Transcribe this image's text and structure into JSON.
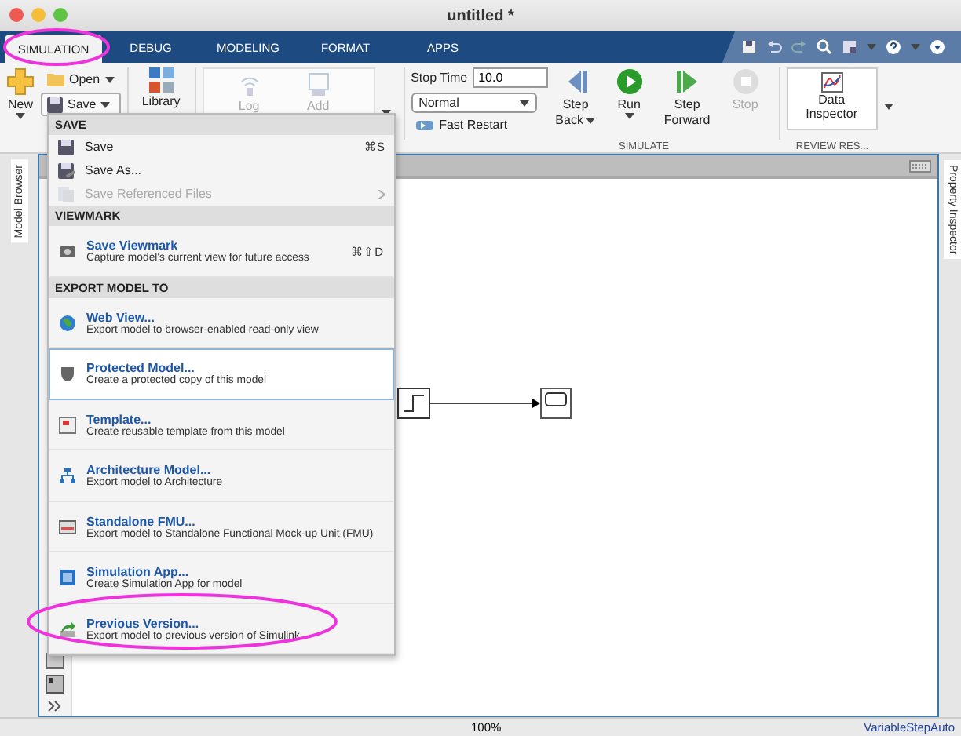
{
  "window": {
    "title": "untitled *"
  },
  "tabs": [
    {
      "label": "SIMULATION",
      "selected": true
    },
    {
      "label": "DEBUG",
      "selected": false
    },
    {
      "label": "MODELING",
      "selected": false
    },
    {
      "label": "FORMAT",
      "selected": false
    },
    {
      "label": "APPS",
      "selected": false
    }
  ],
  "toolstrip": {
    "new": "New",
    "open": "Open",
    "save": "Save",
    "library": "Library",
    "prepare": [
      {
        "label": "Log",
        "disabled": true
      },
      {
        "label": "Add",
        "disabled": true
      }
    ],
    "stop_time": {
      "label": "Stop Time",
      "value": "10.0"
    },
    "mode": {
      "value": "Normal"
    },
    "fast_restart": "Fast Restart",
    "sim_buttons": [
      {
        "kind": "step-back",
        "lines": [
          "Step",
          "Back"
        ],
        "disabled": false,
        "dropdown": true
      },
      {
        "kind": "run",
        "lines": [
          "Run"
        ],
        "disabled": false,
        "dropdown": true
      },
      {
        "kind": "step-forward",
        "lines": [
          "Step",
          "Forward"
        ],
        "disabled": false,
        "dropdown": false
      },
      {
        "kind": "stop",
        "lines": [
          "Stop"
        ],
        "disabled": true,
        "dropdown": false
      }
    ],
    "data_inspector": [
      "Data",
      "Inspector"
    ],
    "sections": [
      "SIMULATE",
      "REVIEW RES..."
    ]
  },
  "menu": {
    "sections": [
      {
        "header": "SAVE",
        "items": [
          {
            "kind": "simple",
            "label": "Save",
            "shortcut": "⌘S",
            "disabled": false,
            "submenu": false
          },
          {
            "kind": "simple",
            "label": "Save As...",
            "disabled": false,
            "submenu": false
          },
          {
            "kind": "simple",
            "label": "Save Referenced Files",
            "disabled": true,
            "submenu": true
          }
        ]
      },
      {
        "header": "VIEWMARK",
        "items": [
          {
            "kind": "rich",
            "title": "Save Viewmark",
            "description": "Capture model's current view for future access",
            "shortcut": "⌘⇧D",
            "selected": false
          }
        ]
      },
      {
        "header": "EXPORT MODEL TO",
        "items": [
          {
            "kind": "rich",
            "title": "Web View...",
            "description": "Export model to browser-enabled read-only view",
            "selected": false
          },
          {
            "kind": "rich",
            "title": "Protected Model...",
            "description": "Create a protected copy of this model",
            "selected": true
          },
          {
            "kind": "rich",
            "title": "Template...",
            "description": "Create reusable template from this model",
            "selected": false
          },
          {
            "kind": "rich",
            "title": "Architecture Model...",
            "description": "Export model to Architecture",
            "selected": false
          },
          {
            "kind": "rich",
            "title": "Standalone FMU...",
            "description": "Export model to Standalone Functional Mock-up Unit (FMU)",
            "selected": false
          },
          {
            "kind": "rich",
            "title": "Simulation App...",
            "description": "Create Simulation App for model",
            "selected": false
          },
          {
            "kind": "rich",
            "title": "Previous Version...",
            "description": "Export model to previous version of Simulink",
            "selected": false
          }
        ]
      }
    ]
  },
  "side_panels": {
    "left": "Model Browser",
    "right": "Property Inspector"
  },
  "status_bar": {
    "zoom": "100%",
    "solver": "VariableStepAuto"
  }
}
